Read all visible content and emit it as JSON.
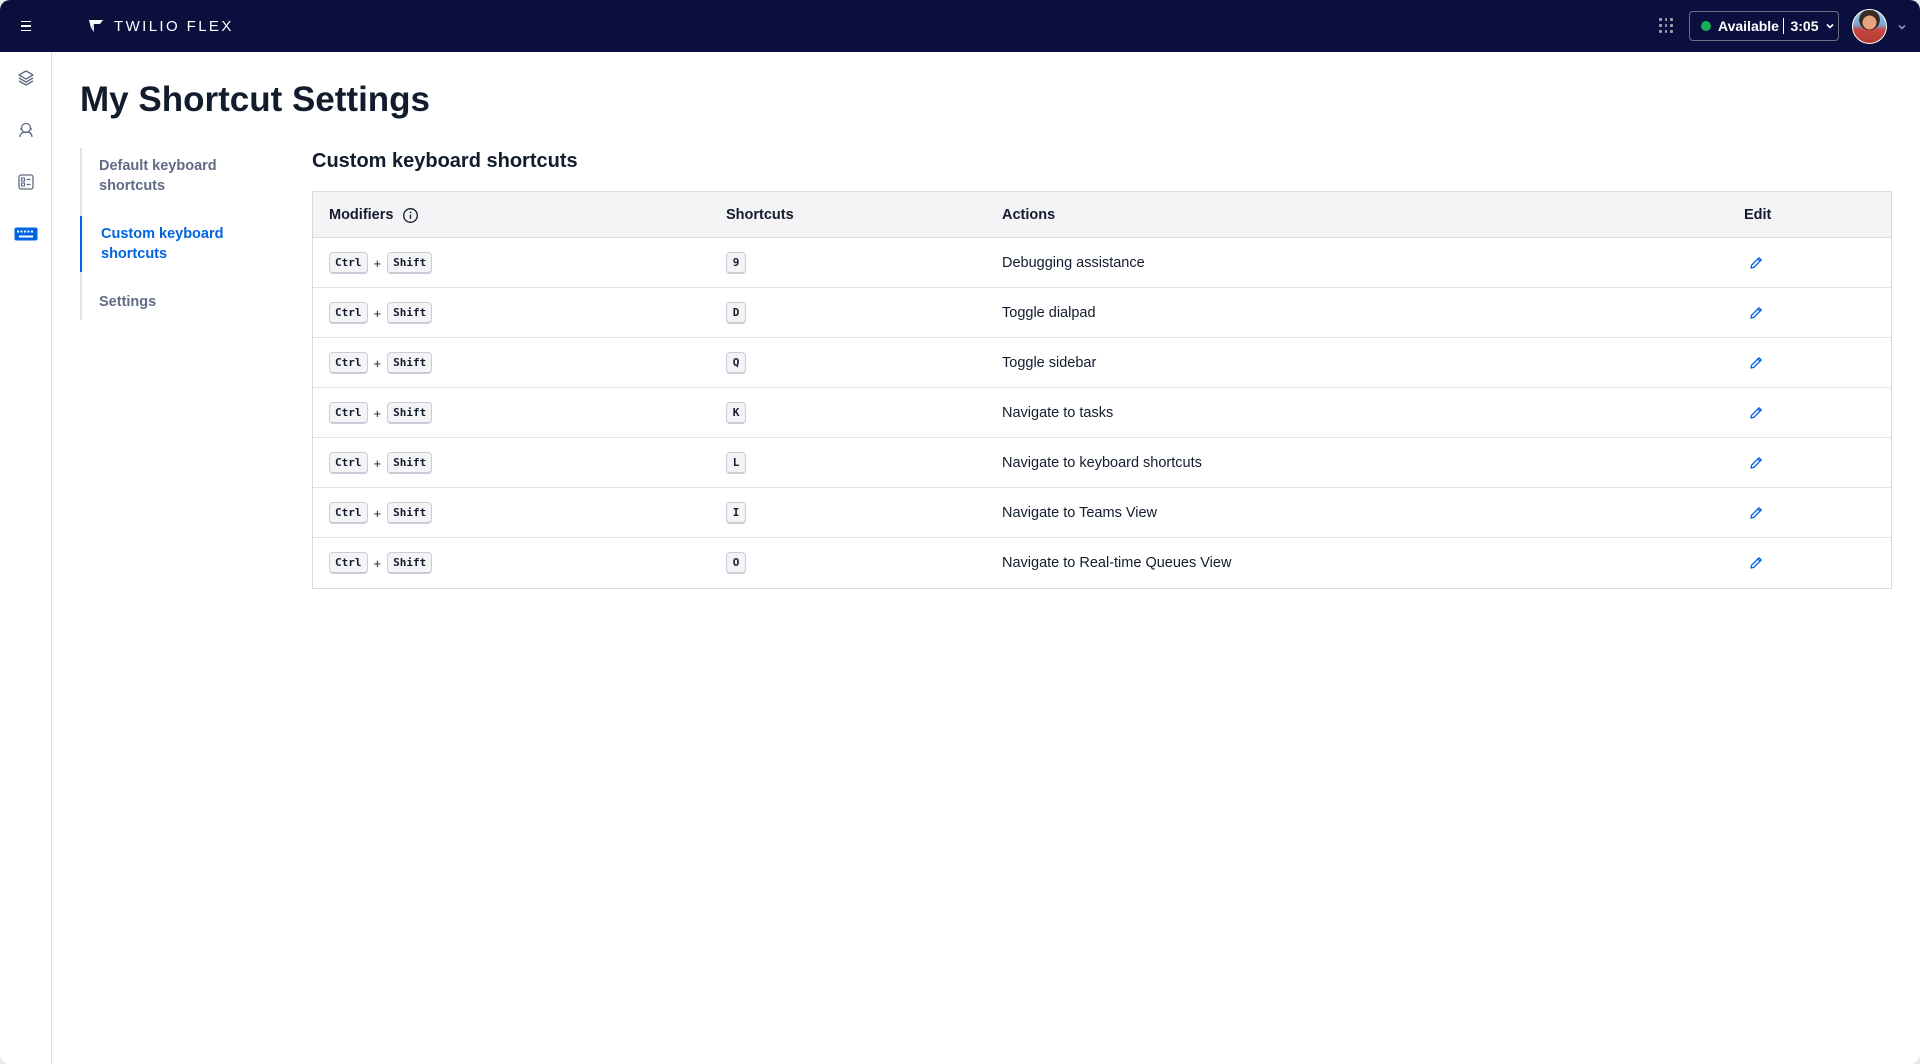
{
  "topbar": {
    "brand": "TWILIO FLEX",
    "status": {
      "label": "Available",
      "timer": "3:05",
      "color": "#14b053"
    }
  },
  "rail": {
    "items": [
      {
        "icon": "layers-icon"
      },
      {
        "icon": "agent-icon"
      },
      {
        "icon": "dashboard-icon"
      },
      {
        "icon": "keyboard-icon",
        "active": true
      }
    ]
  },
  "page": {
    "title": "My Shortcut Settings"
  },
  "subnav": {
    "items": [
      {
        "label_line1": "Default keyboard",
        "label_line2": "shortcuts"
      },
      {
        "label_line1": "Custom keyboard",
        "label_line2": "shortcuts",
        "active": true
      },
      {
        "label_line1": "Settings",
        "label_line2": ""
      }
    ]
  },
  "section": {
    "title": "Custom keyboard shortcuts"
  },
  "table": {
    "headers": {
      "modifiers": "Modifiers",
      "shortcuts": "Shortcuts",
      "actions": "Actions",
      "edit": "Edit"
    },
    "rows": [
      {
        "mod1": "Ctrl",
        "plus": "+",
        "mod2": "Shift",
        "key": "9",
        "action": "Debugging assistance"
      },
      {
        "mod1": "Ctrl",
        "plus": "+",
        "mod2": "Shift",
        "key": "D",
        "action": "Toggle dialpad"
      },
      {
        "mod1": "Ctrl",
        "plus": "+",
        "mod2": "Shift",
        "key": "Q",
        "action": "Toggle sidebar"
      },
      {
        "mod1": "Ctrl",
        "plus": "+",
        "mod2": "Shift",
        "key": "K",
        "action": "Navigate to tasks"
      },
      {
        "mod1": "Ctrl",
        "plus": "+",
        "mod2": "Shift",
        "key": "L",
        "action": "Navigate to keyboard shortcuts"
      },
      {
        "mod1": "Ctrl",
        "plus": "+",
        "mod2": "Shift",
        "key": "I",
        "action": "Navigate to Teams View"
      },
      {
        "mod1": "Ctrl",
        "plus": "+",
        "mod2": "Shift",
        "key": "O",
        "action": "Navigate to Real-time Queues View"
      }
    ]
  },
  "colors": {
    "topbar": "#0b0f3d",
    "accent": "#0263e0",
    "text": "#121c2d",
    "muted": "#606b85"
  }
}
